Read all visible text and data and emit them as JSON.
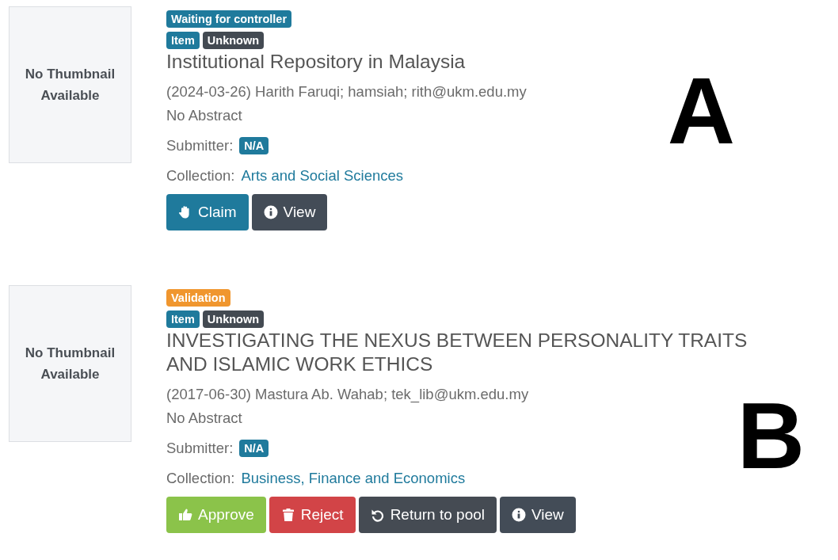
{
  "records": [
    {
      "thumbnail": "No Thumbnail Available",
      "status": {
        "label": "Waiting for controller",
        "color": "#1f7a9c"
      },
      "tags": [
        "Item",
        "Unknown"
      ],
      "title": "Institutional Repository in Malaysia",
      "meta": "(2024-03-26) Harith Faruqi; hamsiah; rith@ukm.edu.my",
      "abstract": "No Abstract",
      "submitter_label": "Submitter:",
      "submitter": "N/A",
      "collection_label": "Collection:",
      "collection": "Arts and Social Sciences",
      "marker": "A",
      "buttons": [
        {
          "kind": "claim",
          "label": "Claim"
        },
        {
          "kind": "view",
          "label": "View"
        }
      ]
    },
    {
      "thumbnail": "No Thumbnail Available",
      "status": {
        "label": "Validation",
        "color": "#f0962e"
      },
      "tags": [
        "Item",
        "Unknown"
      ],
      "title": "INVESTIGATING THE NEXUS BETWEEN PERSONALITY TRAITS AND ISLAMIC WORK ETHICS",
      "meta": "(2017-06-30) Mastura Ab. Wahab; tek_lib@ukm.edu.my",
      "abstract": "No Abstract",
      "submitter_label": "Submitter:",
      "submitter": "N/A",
      "collection_label": "Collection:",
      "collection": "Business, Finance and Economics",
      "marker": "B",
      "buttons": [
        {
          "kind": "approve",
          "label": "Approve"
        },
        {
          "kind": "reject",
          "label": "Reject"
        },
        {
          "kind": "return",
          "label": "Return to pool"
        },
        {
          "kind": "view",
          "label": "View"
        }
      ]
    }
  ]
}
